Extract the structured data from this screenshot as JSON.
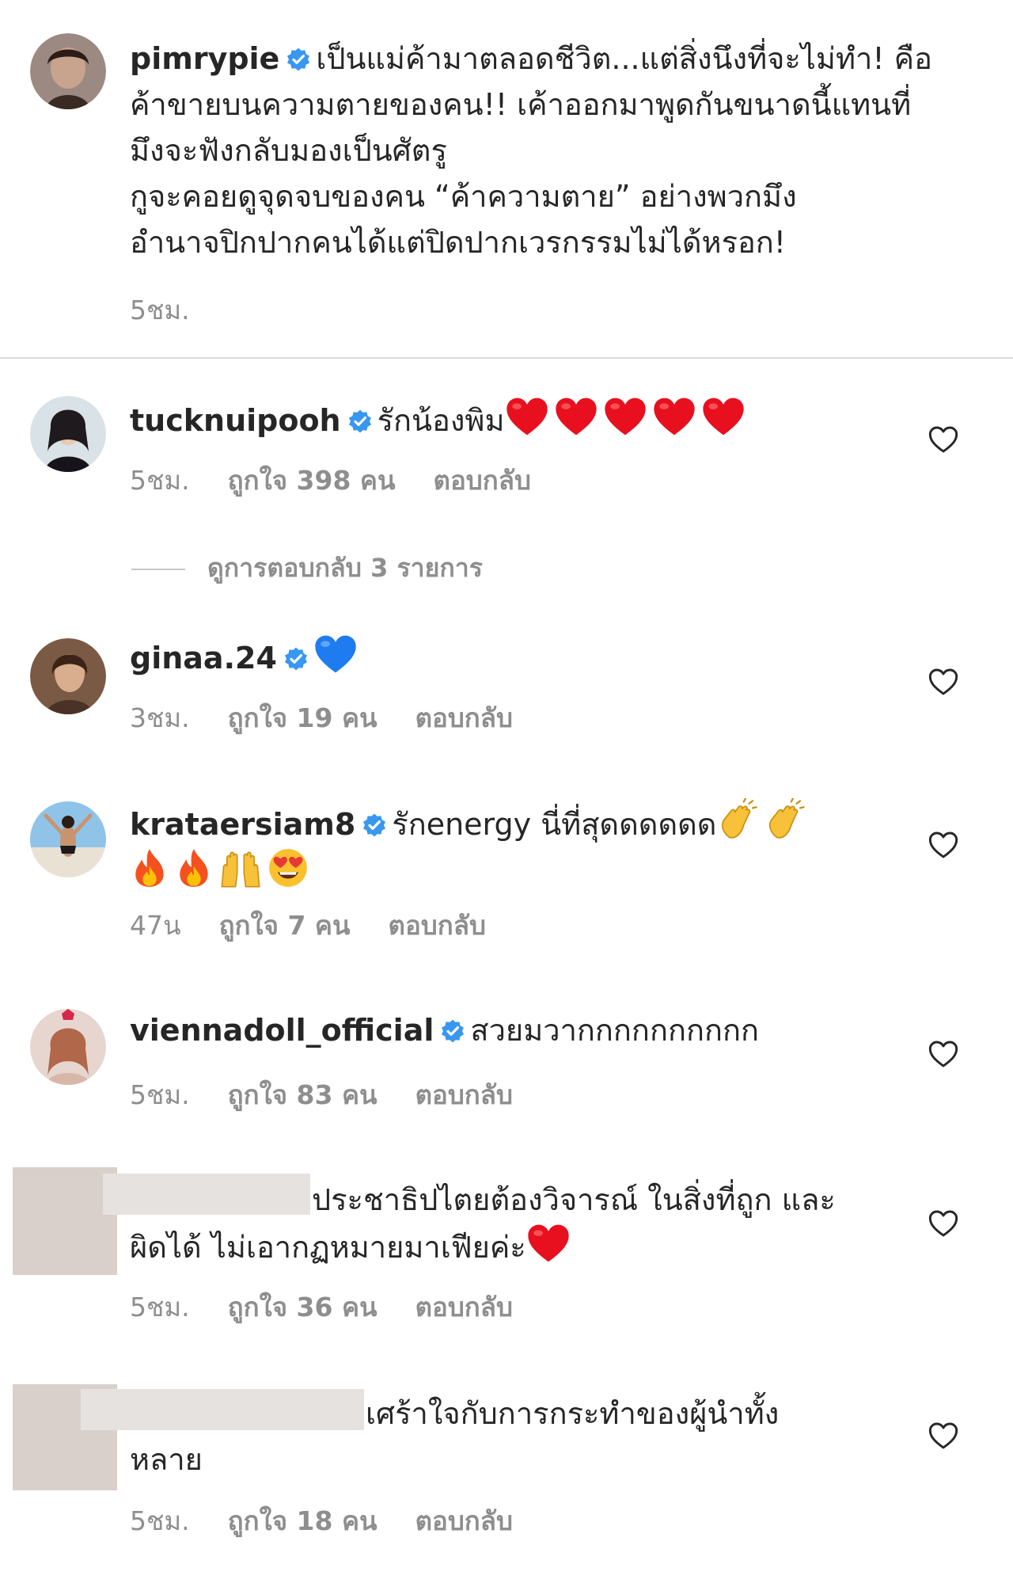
{
  "caption": {
    "username": "pimrypie",
    "lines": [
      "เป็นแม่ค้ามาตลอดชีวิต...แต่สิ่งนึงที่จะไม่ทำ! คือ",
      "ค้าขายบนความตายของคน!! เค้าออกมาพูดกันขนาดนี้แทนที่",
      "มึงจะฟังกลับมองเป็นศัตรู",
      "กูจะคอยดูจุดจบของคน “ค้าความตาย” อย่างพวกมึง",
      "อำนาจปิกปากคนได้แต่ปิดปากเวรกรรมไม่ได้หรอก!"
    ],
    "time": "5ชม."
  },
  "view_replies_label": "ดูการตอบกลับ 3 รายการ",
  "reply_label": "ตอบกลับ",
  "comments": [
    {
      "username": "tucknuipooh",
      "text": "รักน้องพิม",
      "time": "5ชม.",
      "likes": "ถูกใจ 398 คน",
      "emojis": [
        "red-heart-emoji",
        "red-heart-emoji",
        "red-heart-emoji",
        "red-heart-emoji",
        "red-heart-emoji"
      ]
    },
    {
      "username": "ginaa.24",
      "text": "",
      "time": "3ชม.",
      "likes": "ถูกใจ 19 คน",
      "emojis": [
        "blue-heart-emoji"
      ]
    },
    {
      "username": "krataersiam8",
      "text": "รักenergy นี่ที่สุดดดดดด",
      "time": "47น",
      "likes": "ถูกใจ 7 คน",
      "emojis": [
        "clapping-hands-emoji",
        "clapping-hands-emoji",
        "fire-emoji",
        "fire-emoji",
        "raising-hands-emoji",
        "heart-eyes-emoji"
      ]
    },
    {
      "username": "viennadoll_official",
      "text": "สวยมวากกกกกกกกกก",
      "time": "5ชม.",
      "likes": "ถูกใจ 83 คน",
      "emojis": []
    },
    {
      "username": "",
      "lines": [
        "ประชาธิปไตยต้องวิจารณ์ ในสิ่งที่ถูก และ",
        "ผิดได้ ไม่เอากฏหมายมาเฟียค่ะ"
      ],
      "time": "5ชม.",
      "likes": "ถูกใจ 36 คน",
      "emojis": [
        "red-heart-emoji"
      ]
    },
    {
      "username": "",
      "lines": [
        "เศร้าใจกับการกระทำของผู้นำทั้ง",
        "หลาย"
      ],
      "time": "5ชม.",
      "likes": "ถูกใจ 18 คน",
      "emojis": []
    }
  ],
  "colors": {
    "text": "#262626",
    "meta": "#8e8e8e",
    "verified": "#3897f0",
    "divider": "#dbdbdb",
    "heart_red": "#e8101f",
    "heart_blue": "#1e7bf0"
  }
}
